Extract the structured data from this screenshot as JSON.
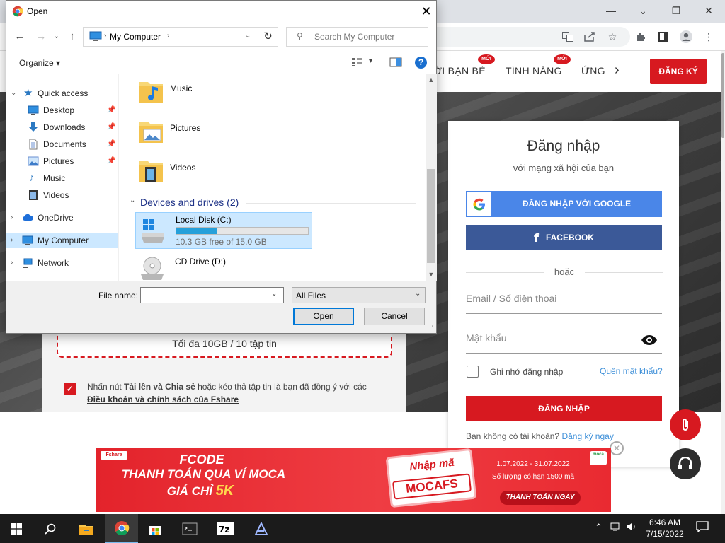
{
  "browser": {
    "win_minimize": "—",
    "win_maximize": "❐",
    "win_close": "✕",
    "toolbar_icons": [
      "translate-icon",
      "share-icon",
      "star-icon",
      "extensions-icon",
      "sidebar-icon",
      "profile-icon",
      "menu-icon"
    ]
  },
  "site": {
    "nav": [
      {
        "label": "ỜI BẠN BÈ",
        "badge": "MỚI"
      },
      {
        "label": "TÍNH NĂNG",
        "badge": "MỚI"
      },
      {
        "label": "ỨNG",
        "badge": ""
      }
    ],
    "nav_next": "›",
    "register_label": "ĐĂNG KÝ",
    "upload": {
      "limit_text": "Tối đa 10GB / 10 tập tin",
      "terms_prefix": "Nhấn nút ",
      "terms_bold": "Tải lên và Chia sẻ",
      "terms_middle": " hoặc kéo thả tập tin là bạn đã đồng ý với các",
      "terms_link": "Điều khoản và chính sách của Fshare"
    },
    "login": {
      "title": "Đăng nhập",
      "subtitle": "với mạng xã hội của bạn",
      "google_label": "ĐĂNG NHẬP VỚI GOOGLE",
      "facebook_label": "FACEBOOK",
      "or_text": "hoặc",
      "email_placeholder": "Email / Số điện thoại",
      "password_placeholder": "Mật khẩu",
      "remember_label": "Ghi nhớ đăng nhập",
      "forgot_label": "Quên mật khẩu?",
      "submit_label": "ĐĂNG NHẬP",
      "no_account_text": "Bạn không có tài khoản?",
      "signup_link": "Đăng ký ngay"
    },
    "banner": {
      "brand": "Fshare",
      "line1": "FCODE",
      "line2": "THANH TOÁN QUA VÍ MOCA",
      "line3_prefix": "GIÁ CHỈ ",
      "line3_price": "5K",
      "code_title": "Nhập mã",
      "code_value": "MOCAFS",
      "dates": "1.07.2022 - 31.07.2022",
      "quantity": "Số lượng có hạn 1500 mã",
      "cta": "THANH TOÁN NGAY",
      "moca_logo": "moca"
    }
  },
  "dialog": {
    "title": "Open",
    "close_label": "✕",
    "address_path": "My Computer",
    "search_placeholder": "Search My Computer",
    "organize_label": "Organize ▾",
    "nav_items": [
      {
        "label": "Quick access",
        "icon": "star-icon",
        "level": 0,
        "expand": "⌄"
      },
      {
        "label": "Desktop",
        "icon": "desktop-icon",
        "level": 1,
        "pin": true
      },
      {
        "label": "Downloads",
        "icon": "download-icon",
        "level": 1,
        "pin": true
      },
      {
        "label": "Documents",
        "icon": "document-icon",
        "level": 1,
        "pin": true
      },
      {
        "label": "Pictures",
        "icon": "pictures-icon",
        "level": 1,
        "pin": true
      },
      {
        "label": "Music",
        "icon": "music-icon",
        "level": 1,
        "pin": false
      },
      {
        "label": "Videos",
        "icon": "video-icon",
        "level": 1,
        "pin": false
      },
      {
        "label": "OneDrive",
        "icon": "cloud-icon",
        "level": 0,
        "expand": "›"
      },
      {
        "label": "My Computer",
        "icon": "computer-icon",
        "level": 0,
        "expand": "›",
        "selected": true
      },
      {
        "label": "Network",
        "icon": "network-icon",
        "level": 0,
        "expand": "›"
      }
    ],
    "folders": [
      {
        "label": "Music",
        "icon": "music-folder-icon"
      },
      {
        "label": "Pictures",
        "icon": "pictures-folder-icon"
      },
      {
        "label": "Videos",
        "icon": "videos-folder-icon"
      }
    ],
    "drives_header": "Devices and drives (2)",
    "drives": [
      {
        "name": "Local Disk (C:)",
        "free": "10.3 GB free of 15.0 GB",
        "used_fraction": 0.31,
        "selected": true
      },
      {
        "name": "CD Drive (D:)",
        "free": "",
        "used_fraction": null,
        "selected": false
      }
    ],
    "file_name_label": "File name:",
    "file_name_value": "",
    "filter_value": "All Files",
    "open_label": "Open",
    "cancel_label": "Cancel"
  },
  "taskbar": {
    "time": "6:46 AM",
    "date": "7/15/2022",
    "apps": [
      "windows-icon",
      "search-icon",
      "file-explorer-icon",
      "chrome-icon",
      "store-icon",
      "terminal-icon",
      "7zip-icon",
      "app-icon"
    ]
  }
}
